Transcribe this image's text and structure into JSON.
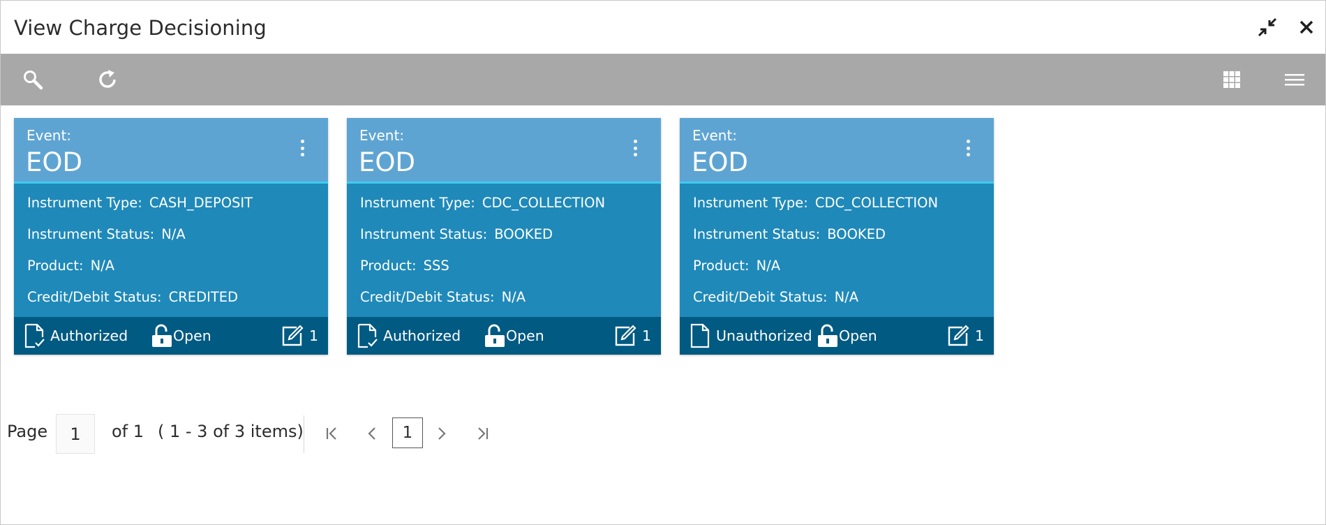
{
  "window": {
    "title": "View Charge Decisioning",
    "minimize_icon": "collapse-arrows-icon",
    "close_icon": "close-icon"
  },
  "toolbar": {
    "left": [
      "search-icon",
      "refresh-icon"
    ],
    "right": [
      "grid-view-icon",
      "list-view-icon"
    ]
  },
  "cards": [
    {
      "event_label": "Event:",
      "event_value": "EOD",
      "fields": [
        {
          "label": "Instrument Type:",
          "value": "CASH_DEPOSIT"
        },
        {
          "label": "Instrument Status:",
          "value": "N/A"
        },
        {
          "label": "Product:",
          "value": "N/A"
        },
        {
          "label": "Credit/Debit Status:",
          "value": "CREDITED"
        }
      ],
      "status": "Authorized",
      "lock": "Open",
      "edit_count": "1"
    },
    {
      "event_label": "Event:",
      "event_value": "EOD",
      "fields": [
        {
          "label": "Instrument Type:",
          "value": "CDC_COLLECTION"
        },
        {
          "label": "Instrument Status:",
          "value": "BOOKED"
        },
        {
          "label": "Product:",
          "value": "SSS"
        },
        {
          "label": "Credit/Debit Status:",
          "value": "N/A"
        }
      ],
      "status": "Authorized",
      "lock": "Open",
      "edit_count": "1"
    },
    {
      "event_label": "Event:",
      "event_value": "EOD",
      "fields": [
        {
          "label": "Instrument Type:",
          "value": "CDC_COLLECTION"
        },
        {
          "label": "Instrument Status:",
          "value": "BOOKED"
        },
        {
          "label": "Product:",
          "value": "N/A"
        },
        {
          "label": "Credit/Debit Status:",
          "value": "N/A"
        }
      ],
      "status": "Unauthorized",
      "lock": "Open",
      "edit_count": "1"
    }
  ],
  "pagination": {
    "page_label": "Page",
    "page_value": "1",
    "of_label": "of 1",
    "range_label": "( 1 - 3 of 3 items)",
    "current_page": "1"
  },
  "colors": {
    "toolbar": "#a8a8a8",
    "card_body": "#1f89b9",
    "card_header": "#5ea4d3",
    "card_footer": "#005a82",
    "header_underline": "#3ecbf0"
  }
}
